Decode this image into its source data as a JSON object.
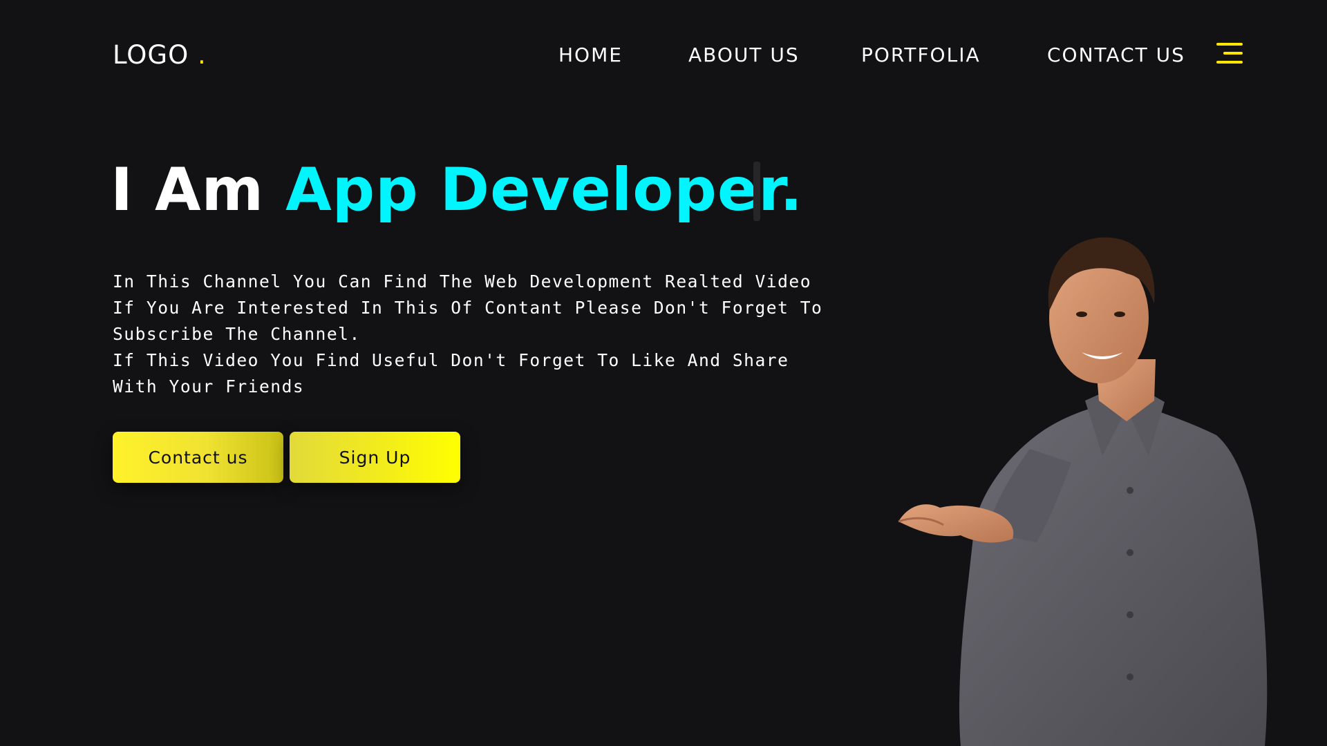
{
  "nav": {
    "logo_text": "LOGO",
    "logo_dot": ".",
    "links": [
      {
        "label": "HOME"
      },
      {
        "label": "ABOUT US"
      },
      {
        "label": "PORTFOLIA"
      },
      {
        "label": "CONTACT US"
      }
    ],
    "menu_icon": "hamburger-icon"
  },
  "hero": {
    "title_prefix": "I Am",
    "title_accent": "App Developer.",
    "description": [
      "In This Channel You Can Find The Web Development Realted Video If You Are Interested In This Of Contant Please Don't Forget To Subscribe The Channel.",
      "If This Video You Find Useful Don't Forget To Like And Share With Your Friends"
    ],
    "buttons": {
      "contact": "Contact us",
      "signup": "Sign Up"
    }
  },
  "colors": {
    "background": "#121113",
    "accent_cyan": "#00f5ff",
    "accent_yellow": "#ffe600",
    "text": "#ffffff"
  }
}
